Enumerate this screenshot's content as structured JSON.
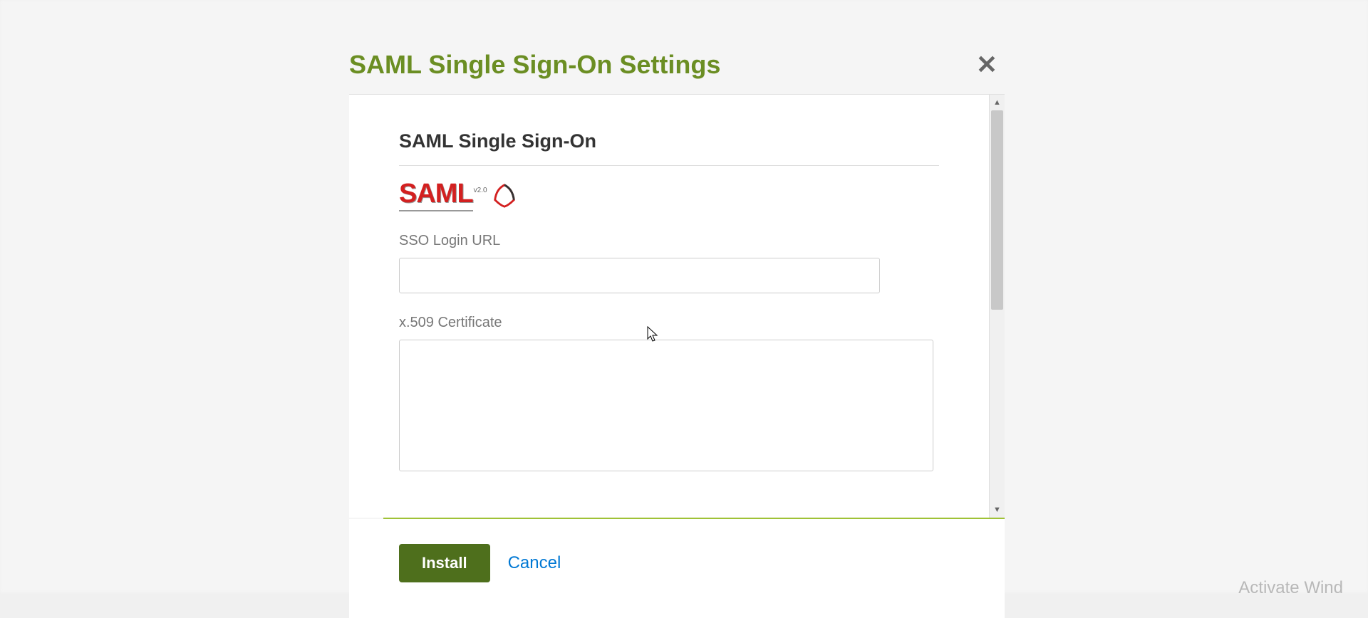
{
  "modal": {
    "title": "SAML Single Sign-On Settings",
    "section_title": "SAML Single Sign-On",
    "logo_text": "SAML",
    "logo_version": "v2.0"
  },
  "form": {
    "sso_login_url": {
      "label": "SSO Login URL",
      "value": ""
    },
    "certificate": {
      "label": "x.509 Certificate",
      "value": ""
    }
  },
  "footer": {
    "install_label": "Install",
    "cancel_label": "Cancel"
  },
  "watermark": "Activate Wind"
}
